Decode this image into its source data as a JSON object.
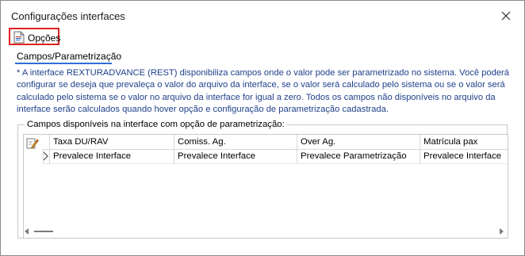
{
  "window": {
    "title": "Configurações interfaces"
  },
  "toolbar": {
    "options_label": "Opções"
  },
  "tabs": [
    {
      "label": "Campos/Parametrização",
      "active": true
    }
  ],
  "info_text": "* A interface REXTURADVANCE (REST) disponibiliza campos onde o valor pode ser parametrizado no sistema. Você poderá configurar se deseja que prevaleça o valor do arquivo da interface, se o valor será calculado pelo sistema ou se o valor será calculado pelo sistema se o valor no arquivo da interface for igual a zero. Todos os campos não disponíveis no arquivo da interface serão calculados quando hover opção e configuração de parametrização cadastrada.",
  "group": {
    "title": "Campos disponíveis na interface com opção de parametrização:"
  },
  "grid": {
    "columns": [
      "Taxa DU/RAV",
      "Comiss. Ag.",
      "Over Ag.",
      "Matrícula pax"
    ],
    "rows": [
      [
        "Prevalece Interface",
        "Prevalece Interface",
        "Prevalece Parametrização",
        "Prevalece Interface"
      ]
    ]
  },
  "colors": {
    "accent": "#2d6fd0",
    "info_text": "#1f3f8a",
    "highlight_border": "#e02020"
  },
  "icons": {
    "close": "close-icon",
    "options": "document-icon",
    "edit": "edit-pencil-icon",
    "row_indicator": "chevron-right-icon",
    "scroll_left": "triangle-left-icon",
    "scroll_right": "triangle-right-icon"
  }
}
